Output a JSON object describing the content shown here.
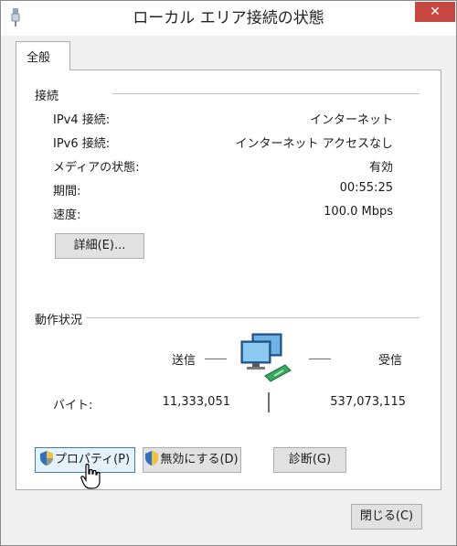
{
  "window": {
    "title": "ローカル エリア接続の状態",
    "close_glyph": "✕"
  },
  "tabs": [
    {
      "label": "全般"
    }
  ],
  "connection": {
    "heading": "接続",
    "rows": [
      {
        "label": "IPv4 接続:",
        "value": "インターネット"
      },
      {
        "label": "IPv6 接続:",
        "value": "インターネット アクセスなし"
      },
      {
        "label": "メディアの状態:",
        "value": "有効"
      },
      {
        "label": "期間:",
        "value": "00:55:25"
      },
      {
        "label": "速度:",
        "value": "100.0 Mbps"
      }
    ],
    "details_button": "詳細(E)..."
  },
  "activity": {
    "heading": "動作状況",
    "sent_label": "送信",
    "received_label": "受信",
    "bytes_label": "バイト:",
    "bytes_sent": "11,333,051",
    "bytes_received": "537,073,115",
    "network_icon": "network-computers-icon"
  },
  "actions": {
    "properties": "プロパティ(P)",
    "disable": "無効にする(D)",
    "diagnose": "診断(G)"
  },
  "footer": {
    "close_button": "閉じる(C)"
  },
  "colors": {
    "close_red": "#c7463f",
    "accent_blue": "#3c7fb1"
  }
}
